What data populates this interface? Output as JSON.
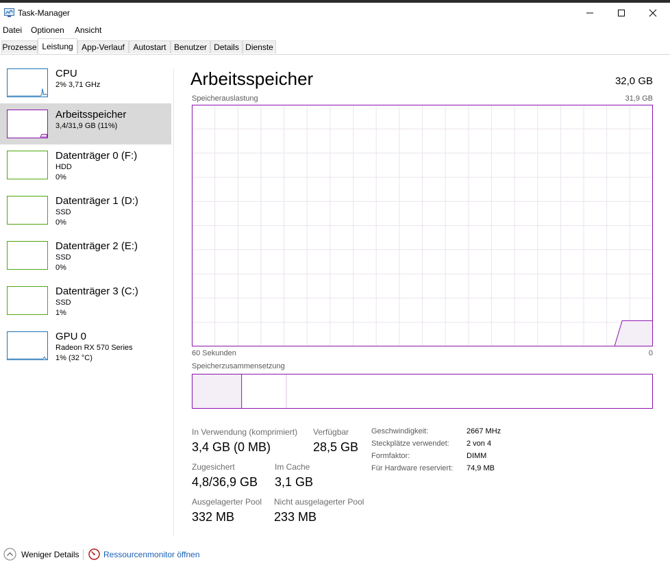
{
  "window": {
    "title": "Task-Manager"
  },
  "menu": [
    "Datei",
    "Optionen",
    "Ansicht"
  ],
  "tabs": [
    "Prozesse",
    "Leistung",
    "App-Verlauf",
    "Autostart",
    "Benutzer",
    "Details",
    "Dienste"
  ],
  "active_tab": "Leistung",
  "sidebar": {
    "items": [
      {
        "title": "CPU",
        "line1": "2% 3,71 GHz",
        "line2": "",
        "color": "#1f73b7"
      },
      {
        "title": "Arbeitsspeicher",
        "line1": "3,4/31,9 GB (11%)",
        "line2": "",
        "color": "#8b12ae"
      },
      {
        "title": "Datenträger 0 (F:)",
        "line1": "HDD",
        "line2": "0%",
        "color": "#4da60c"
      },
      {
        "title": "Datenträger 1 (D:)",
        "line1": "SSD",
        "line2": "0%",
        "color": "#4da60c"
      },
      {
        "title": "Datenträger 2 (E:)",
        "line1": "SSD",
        "line2": "0%",
        "color": "#4da60c"
      },
      {
        "title": "Datenträger 3 (C:)",
        "line1": "SSD",
        "line2": "1%",
        "color": "#4da60c"
      },
      {
        "title": "GPU 0",
        "line1": "Radeon RX 570 Series",
        "line2": "1% (32 °C)",
        "color": "#1f73b7"
      }
    ]
  },
  "main": {
    "title": "Arbeitsspeicher",
    "total": "32,0 GB",
    "usage_label": "Speicherauslastung",
    "usage_max": "31,9 GB",
    "x_left": "60 Sekunden",
    "x_right": "0",
    "composition_label": "Speicherzusammensetzung",
    "composition": {
      "in_use_fraction": 0.108,
      "modified_fraction": 0.097
    },
    "stats": {
      "in_use_label": "In Verwendung (komprimiert)",
      "in_use_value": "3,4 GB (0 MB)",
      "available_label": "Verfügbar",
      "available_value": "28,5 GB",
      "committed_label": "Zugesichert",
      "committed_value": "4,8/36,9 GB",
      "cached_label": "Im Cache",
      "cached_value": "3,1 GB",
      "paged_label": "Ausgelagerter Pool",
      "paged_value": "332 MB",
      "nonpaged_label": "Nicht ausgelagerter Pool",
      "nonpaged_value": "233 MB"
    },
    "details": [
      {
        "label": "Geschwindigkeit:",
        "value": "2667 MHz"
      },
      {
        "label": "Steckplätze verwendet:",
        "value": "2 von 4"
      },
      {
        "label": "Formfaktor:",
        "value": "DIMM"
      },
      {
        "label": "Für Hardware reserviert:",
        "value": "74,9 MB"
      }
    ]
  },
  "chart_data": {
    "type": "area",
    "x": [
      60,
      0
    ],
    "xlabel": "60 Sekunden",
    "ylabel": "Speicherauslastung",
    "ylim": [
      0,
      31.9
    ],
    "series": [
      {
        "points": [
          [
            60,
            0
          ],
          [
            5,
            0
          ],
          [
            4,
            3.4
          ],
          [
            0,
            3.4
          ]
        ],
        "color": "#8b12ae"
      }
    ],
    "grid": true
  },
  "footer": {
    "fewer_details": "Weniger Details",
    "resource_monitor": "Ressourcenmonitor öffnen"
  }
}
